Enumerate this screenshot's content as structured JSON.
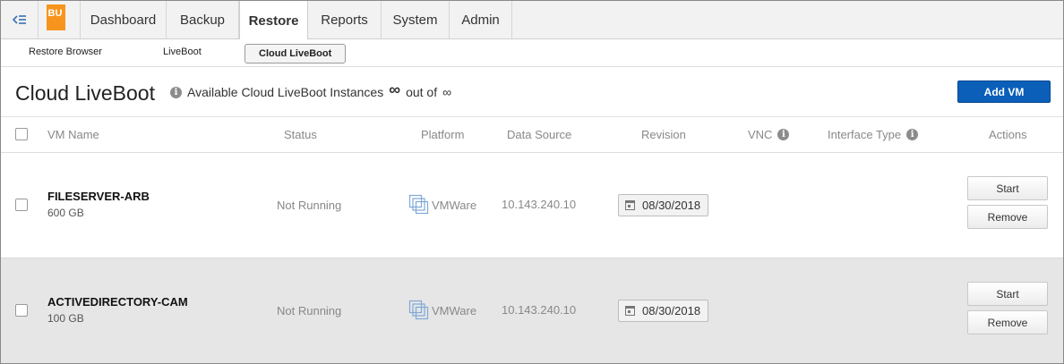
{
  "brand": {
    "logo_text": "BU",
    "logo_color": "#f7941d"
  },
  "nav": {
    "toggle_icon": "collapse-menu-icon",
    "tabs": [
      {
        "label": "Dashboard",
        "active": false
      },
      {
        "label": "Backup",
        "active": false
      },
      {
        "label": "Restore",
        "active": true
      },
      {
        "label": "Reports",
        "active": false
      },
      {
        "label": "System",
        "active": false
      },
      {
        "label": "Admin",
        "active": false
      }
    ]
  },
  "subnav": {
    "tabs": [
      {
        "label": "Restore Browser",
        "active": false
      },
      {
        "label": "LiveBoot",
        "active": false
      },
      {
        "label": "Cloud LiveBoot",
        "active": true
      }
    ]
  },
  "header": {
    "title": "Cloud LiveBoot",
    "available_label": "Available Cloud LiveBoot Instances",
    "available_count": "∞",
    "out_of_label": "out of",
    "out_of_total": "∞",
    "add_button": "Add VM",
    "accent_color": "#0b5fb8"
  },
  "table": {
    "columns": {
      "vm_name": "VM Name",
      "status": "Status",
      "platform": "Platform",
      "data_source": "Data Source",
      "revision": "Revision",
      "vnc": "VNC",
      "interface_type": "Interface Type",
      "actions": "Actions"
    },
    "rows": [
      {
        "name": "FILESERVER-ARB",
        "size": "600 GB",
        "status": "Not Running",
        "platform": "VMWare",
        "data_source": "10.143.240.10",
        "revision": "08/30/2018",
        "start_label": "Start",
        "remove_label": "Remove"
      },
      {
        "name": "ACTIVEDIRECTORY-CAM",
        "size": "100 GB",
        "status": "Not Running",
        "platform": "VMWare",
        "data_source": "10.143.240.10",
        "revision": "08/30/2018",
        "start_label": "Start",
        "remove_label": "Remove"
      }
    ]
  }
}
